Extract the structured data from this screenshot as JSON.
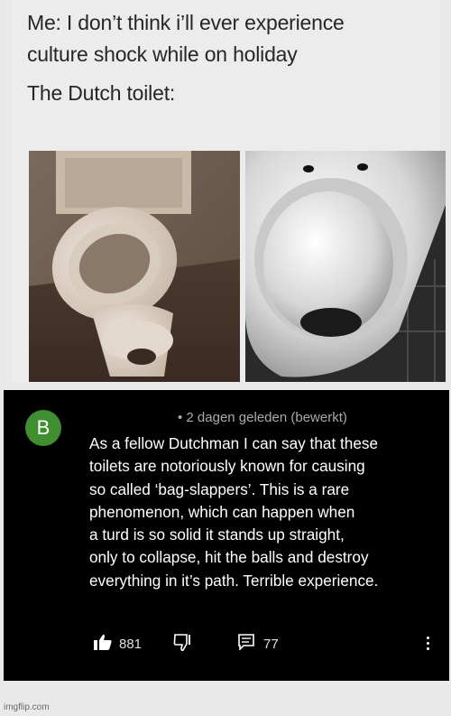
{
  "meme": {
    "caption_lines": [
      "Me: I don’t think i’ll ever experience",
      "culture shock while on holiday",
      "The Dutch toilet:"
    ]
  },
  "comment": {
    "avatar_letter": "B",
    "meta": "• 2 dagen geleden (bewerkt)",
    "lines": [
      "As a fellow Dutchman I can say that these",
      "toilets are notoriously known for causing",
      "so called ‘bag-slappers’. This is a rare",
      "phenomenon, which can happen when",
      "a turd is so solid it stands up straight,",
      "only to collapse, hit the balls and destroy",
      "everything in it’s path. Terrible experience."
    ],
    "likes": "881",
    "replies": "77",
    "icons": {
      "like": "thumbs-up-icon",
      "dislike": "thumbs-down-icon",
      "reply": "reply-icon",
      "more": "more-vertical-icon"
    }
  },
  "watermark": "imgflip.com",
  "colors": {
    "avatar": "#3f8e2f",
    "comment_bg": "#000000",
    "meta_text": "#aaaaaa"
  }
}
